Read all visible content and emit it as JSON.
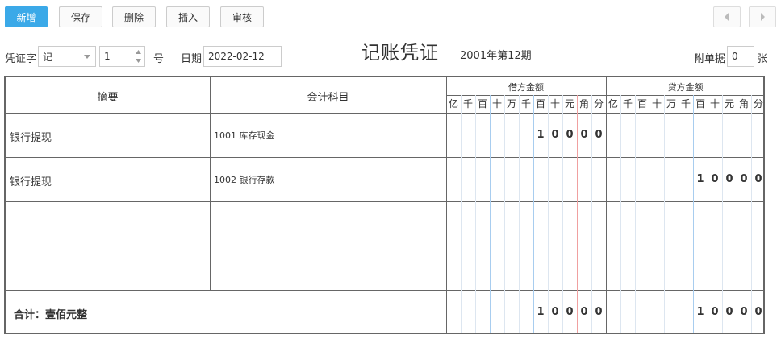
{
  "toolbar": {
    "new_label": "新增",
    "save_label": "保存",
    "delete_label": "删除",
    "insert_label": "插入",
    "audit_label": "审核"
  },
  "header": {
    "voucher_word_label": "凭证字",
    "voucher_word_value": "记",
    "voucher_no_value": "1",
    "hao_label": "号",
    "date_label": "日期",
    "date_value": "2022-02-12",
    "title": "记账凭证",
    "period": "2001年第12期",
    "attach_label": "附单据",
    "attach_value": "0",
    "zhang_label": "张"
  },
  "table": {
    "col_summary": "摘要",
    "col_account": "会计科目",
    "col_debit": "借方金额",
    "col_credit": "贷方金额",
    "units": [
      "亿",
      "千",
      "百",
      "十",
      "万",
      "千",
      "百",
      "十",
      "元",
      "角",
      "分"
    ],
    "rows": [
      {
        "summary": "银行提现",
        "account": "1001 库存现金",
        "debit": "10000",
        "credit": ""
      },
      {
        "summary": "银行提现",
        "account": "1002 银行存款",
        "debit": "",
        "credit": "10000"
      },
      {
        "summary": "",
        "account": "",
        "debit": "",
        "credit": ""
      },
      {
        "summary": "",
        "account": "",
        "debit": "",
        "credit": ""
      }
    ],
    "total_label": "合计：壹佰元整",
    "total_debit": "10000",
    "total_credit": "10000"
  },
  "colors": {
    "primary": "#3ba9e8",
    "grid_blue": "#a8cdef",
    "grid_red": "#f0a0a0",
    "grid_light": "#dde6f0"
  }
}
